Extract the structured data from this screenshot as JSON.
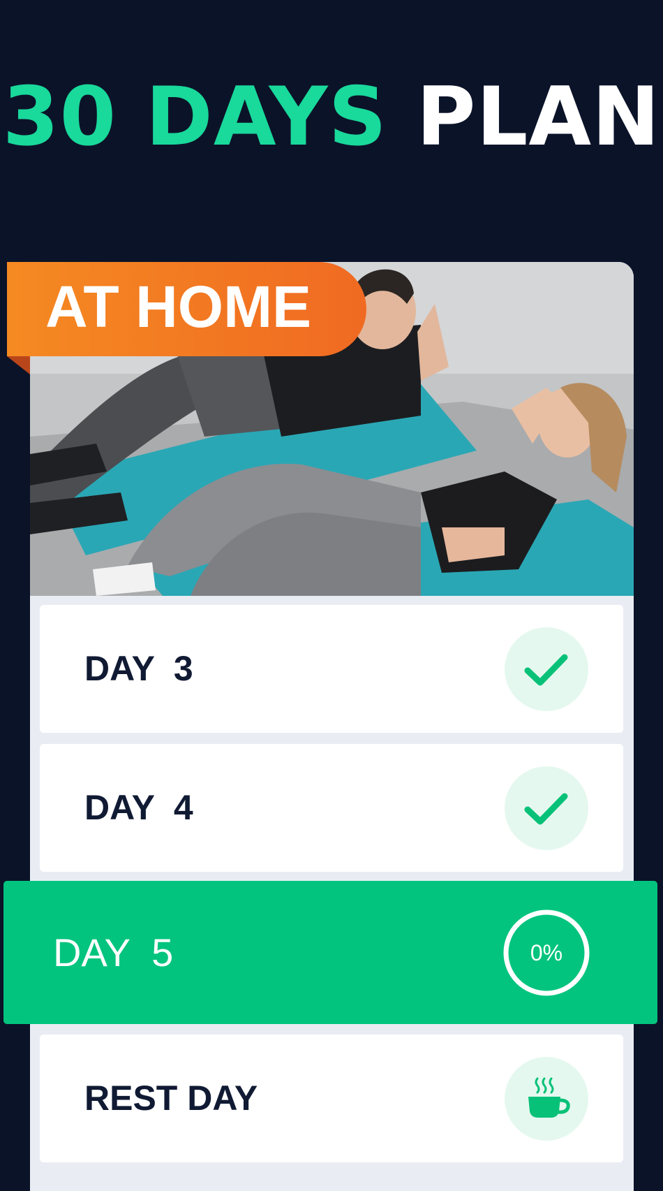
{
  "header": {
    "title_accent": "30 DAYS",
    "title_plain": "PLAN"
  },
  "hero": {
    "badge_label": "AT HOME"
  },
  "days": [
    {
      "label": "DAY  3",
      "status": "completed",
      "icon": "check-icon"
    },
    {
      "label": "DAY  4",
      "status": "completed",
      "icon": "check-icon"
    },
    {
      "label": "DAY  5",
      "status": "current",
      "progress_text": "0%",
      "progress_percent": 0
    },
    {
      "label": "REST DAY",
      "status": "rest",
      "icon": "coffee-cup-icon"
    }
  ],
  "colors": {
    "background": "#0b1329",
    "accent": "#19d99b",
    "active_row": "#03c47e",
    "ribbon": "#f27a22",
    "text_dark": "#101a33"
  }
}
